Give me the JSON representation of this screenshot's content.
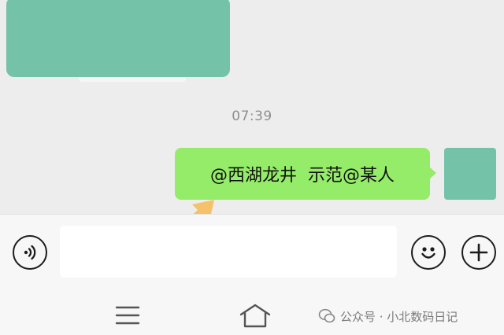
{
  "chat": {
    "timestamp": "07:39",
    "message": "@西湖龙井  示范@某人"
  },
  "input": {
    "value": "",
    "placeholder": ""
  },
  "icons": {
    "voice": "voice-icon",
    "emoji": "emoji-icon",
    "plus": "plus-icon",
    "menu": "menu-icon",
    "home": "home-icon",
    "arrow": "arrow-icon"
  },
  "watermark": {
    "text": "公众号 · 小北数码日记"
  },
  "colors": {
    "background": "#ededed",
    "self_bubble": "#95ec69",
    "placeholder_block": "#74c3a8",
    "arrow": "#f5c26b",
    "bar": "#f7f7f7"
  }
}
